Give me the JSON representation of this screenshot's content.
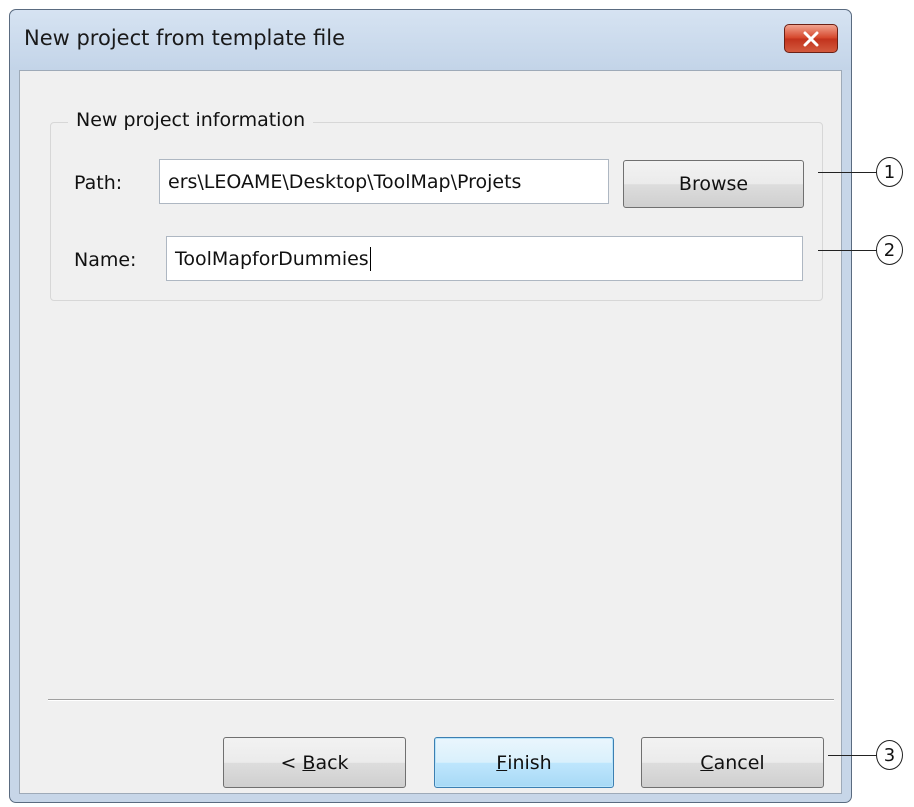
{
  "window": {
    "title": "New project from template file"
  },
  "group": {
    "label": "New project information"
  },
  "path": {
    "label": "Path:",
    "value": "ers\\LEOAME\\Desktop\\ToolMap\\Projets",
    "browse_label": "Browse"
  },
  "name": {
    "label": "Name:",
    "value": "ToolMapforDummies"
  },
  "buttons": {
    "back_prefix": "< ",
    "back_mnemonic": "B",
    "back_rest": "ack",
    "finish_mnemonic": "F",
    "finish_rest": "inish",
    "cancel_mnemonic": "C",
    "cancel_rest": "ancel"
  },
  "callouts": [
    "1",
    "2",
    "3"
  ],
  "colors": {
    "frame": "#c7d6e8",
    "client": "#f0f0f0",
    "close_button": "#c2331d",
    "default_button_border": "#3c7fb1"
  },
  "icons": {
    "close": "close-x-icon"
  }
}
